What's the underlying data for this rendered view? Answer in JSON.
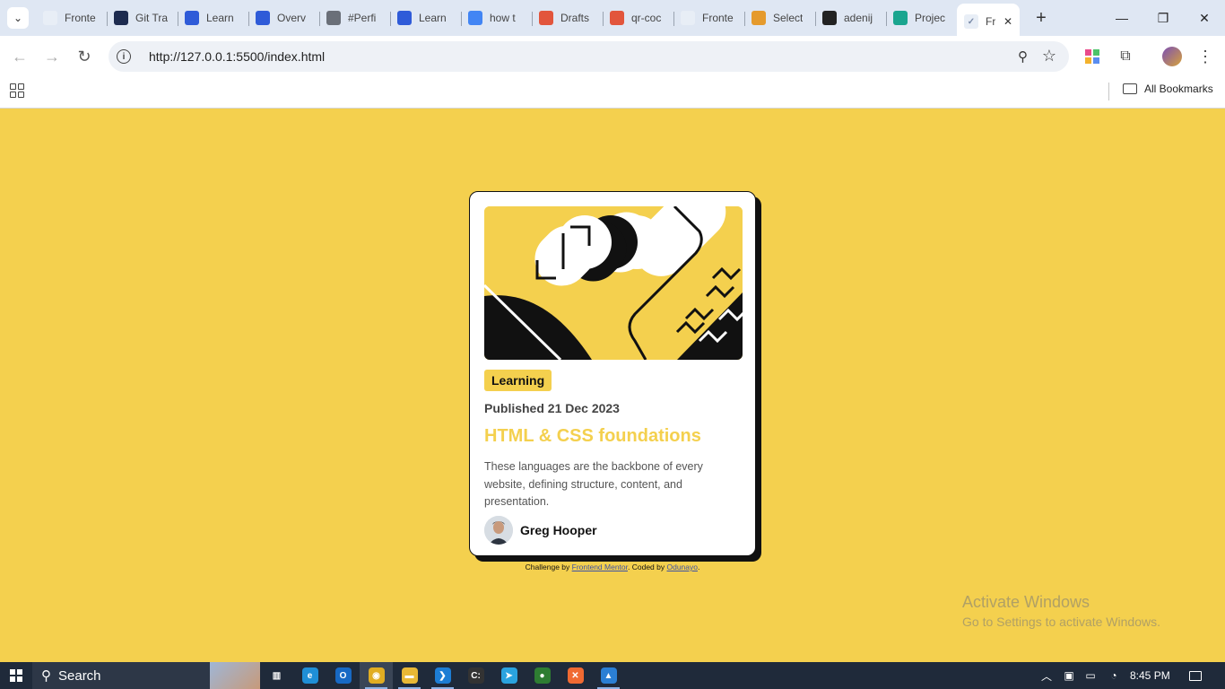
{
  "browser": {
    "tabs": [
      {
        "label": "Fronte",
        "icon": "frontend-mentor-icon",
        "color": "#e8eef6"
      },
      {
        "label": "Git Tra",
        "icon": "git-tracker-icon",
        "color": "#1d2b4f"
      },
      {
        "label": "Learn",
        "icon": "microsoft-learn-icon",
        "color": "#2f5bd8"
      },
      {
        "label": "Overv",
        "icon": "azure-devops-icon",
        "color": "#2f5bd8"
      },
      {
        "label": "#Perfi",
        "icon": "globe-icon",
        "color": "#6a6f78"
      },
      {
        "label": "Learn",
        "icon": "microsoft-learn-icon",
        "color": "#2f5bd8"
      },
      {
        "label": "how t",
        "icon": "google-icon",
        "color": "#4285f4"
      },
      {
        "label": "Drafts",
        "icon": "figma-icon",
        "color": "#e2553c"
      },
      {
        "label": "qr-coc",
        "icon": "figma-icon",
        "color": "#e2553c"
      },
      {
        "label": "Fronte",
        "icon": "frontend-mentor-icon",
        "color": "#e8eef6"
      },
      {
        "label": "Select",
        "icon": "selection-icon",
        "color": "#e59a2c"
      },
      {
        "label": "adenij",
        "icon": "github-icon",
        "color": "#222222"
      },
      {
        "label": "Projec",
        "icon": "diamond-icon",
        "color": "#1aa58f"
      }
    ],
    "active_tab": {
      "label": "Fr",
      "icon": "frontend-mentor-icon"
    },
    "url": "http://127.0.0.1:5500/index.html",
    "bookmarks_label": "All Bookmarks"
  },
  "card": {
    "badge": "Learning",
    "published": "Published 21 Dec 2023",
    "title": "HTML & CSS foundations",
    "description": "These languages are the backbone of every website, defining structure, content, and presentation.",
    "author": "Greg Hooper"
  },
  "attribution": {
    "prefix": "Challenge by ",
    "link1": "Frontend Mentor",
    "middle": ". Coded by ",
    "link2": "Odunayo",
    "suffix": "."
  },
  "watermark": {
    "line1": "Activate Windows",
    "line2": "Go to Settings to activate Windows."
  },
  "taskbar": {
    "search_label": "Search",
    "time": "8:45 PM",
    "apps": [
      {
        "name": "task-view-icon",
        "color": "#2d3747",
        "glyph": "▥"
      },
      {
        "name": "edge-icon",
        "color": "#1f8fd6",
        "glyph": "e"
      },
      {
        "name": "outlook-icon",
        "color": "#1769c4",
        "glyph": "O"
      },
      {
        "name": "chrome-icon",
        "color": "#e1ad22",
        "glyph": "◉"
      },
      {
        "name": "file-explorer-icon",
        "color": "#e8b836",
        "glyph": "▬"
      },
      {
        "name": "vscode-icon",
        "color": "#1d7dd4",
        "glyph": "❯"
      },
      {
        "name": "terminal-icon",
        "color": "#333333",
        "glyph": "C:"
      },
      {
        "name": "telegram-icon",
        "color": "#2aa3df",
        "glyph": "➤"
      },
      {
        "name": "app-icon",
        "color": "#2e7d32",
        "glyph": "●"
      },
      {
        "name": "app-icon-orange",
        "color": "#f06a32",
        "glyph": "✕"
      },
      {
        "name": "photos-icon",
        "color": "#2b7fd4",
        "glyph": "▲"
      }
    ]
  },
  "colors": {
    "page_bg": "#f4d04e",
    "title_color": "#f4d04e",
    "card_border": "#111111"
  }
}
